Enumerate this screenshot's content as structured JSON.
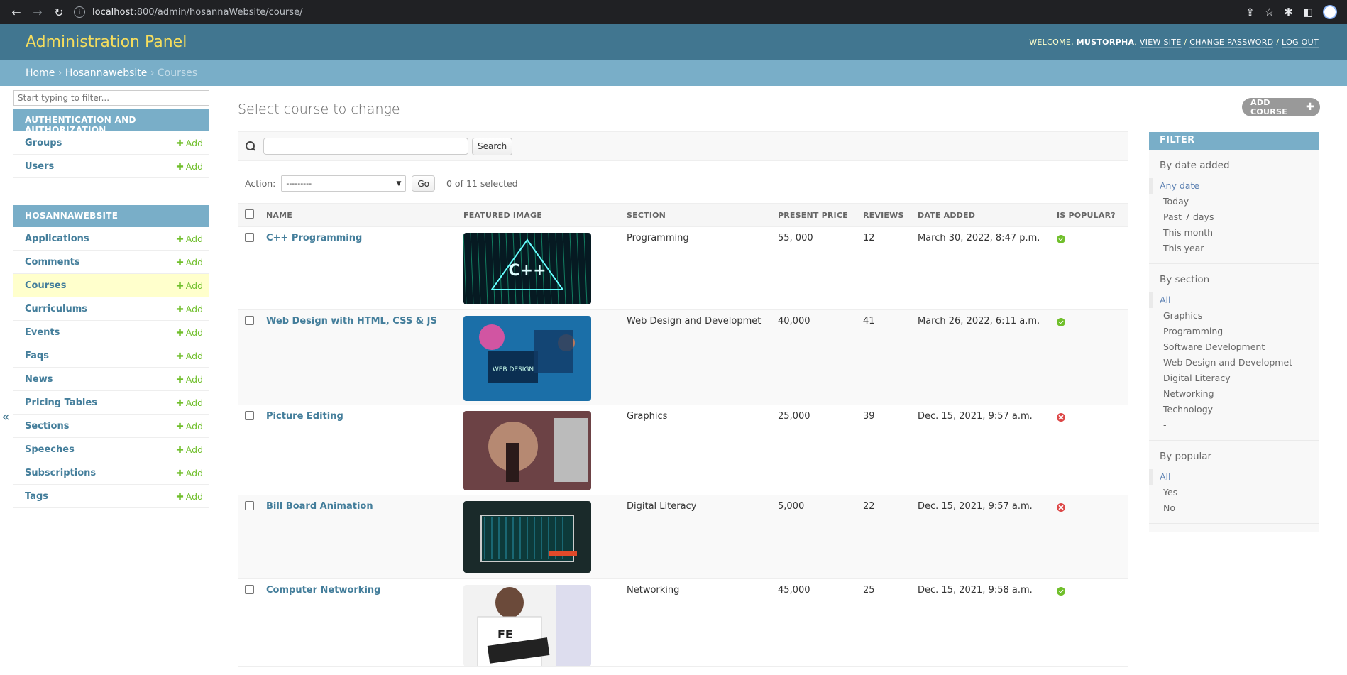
{
  "browser": {
    "url_host": "localhost",
    "url_rest": ":800/admin/hosannaWebsite/course/"
  },
  "header": {
    "branding": "Administration Panel",
    "welcome": "Welcome, ",
    "username": "MUSTORPHA",
    "view_site": "View site",
    "change_password": "Change password",
    "log_out": "Log out"
  },
  "breadcrumbs": {
    "home": "Home",
    "app": "Hosannawebsite",
    "current": "Courses"
  },
  "sidebar": {
    "filter_placeholder": "Start typing to filter...",
    "add_label": "Add",
    "auth_caption": "Authentication and Authorization",
    "auth_models": [
      "Groups",
      "Users"
    ],
    "app_caption": "Hosannawebsite",
    "app_models": [
      "Applications",
      "Comments",
      "Courses",
      "Curriculums",
      "Events",
      "Faqs",
      "News",
      "Pricing Tables",
      "Sections",
      "Speeches",
      "Subscriptions",
      "Tags"
    ],
    "current_model": "Courses",
    "toggle_icon": "«"
  },
  "content": {
    "title": "Select course to change",
    "add_button": "Add course",
    "search_button": "Search",
    "action_label": "Action:",
    "action_selected": "---------",
    "go_button": "Go",
    "counter": "0 of 11 selected"
  },
  "table": {
    "headers": [
      "Name",
      "Featured image",
      "Section",
      "Present price",
      "Reviews",
      "Date added",
      "Is popular?"
    ],
    "rows": [
      {
        "name": "C++ Programming",
        "section": "Programming",
        "price": "55, 000",
        "reviews": "12",
        "date": "March 30, 2022, 8:47 p.m.",
        "popular": true
      },
      {
        "name": "Web Design with HTML, CSS & JS",
        "section": "Web Design and Developmet",
        "price": "40,000",
        "reviews": "41",
        "date": "March 26, 2022, 6:11 a.m.",
        "popular": true
      },
      {
        "name": "Picture Editing",
        "section": "Graphics",
        "price": "25,000",
        "reviews": "39",
        "date": "Dec. 15, 2021, 9:57 a.m.",
        "popular": false
      },
      {
        "name": "Bill Board Animation",
        "section": "Digital Literacy",
        "price": "5,000",
        "reviews": "22",
        "date": "Dec. 15, 2021, 9:57 a.m.",
        "popular": false
      },
      {
        "name": "Computer Networking",
        "section": "Networking",
        "price": "45,000",
        "reviews": "25",
        "date": "Dec. 15, 2021, 9:58 a.m.",
        "popular": true
      }
    ],
    "thumb_text": [
      "C++",
      "WEB DESIGN",
      "",
      "",
      "FE"
    ]
  },
  "filter": {
    "title": "Filter",
    "groups": [
      {
        "title": "By date added",
        "items": [
          "Any date",
          "Today",
          "Past 7 days",
          "This month",
          "This year"
        ]
      },
      {
        "title": "By section",
        "items": [
          "All",
          "Graphics",
          "Programming",
          "Software Development",
          "Web Design and Developmet",
          "Digital Literacy",
          "Networking",
          "Technology",
          "-"
        ]
      },
      {
        "title": "By popular",
        "items": [
          "All",
          "Yes",
          "No"
        ]
      }
    ]
  },
  "colors": {
    "header_bg": "#417690",
    "breadcrumb_bg": "#79aec8",
    "branding": "#f5dd5d",
    "link": "#447e9b",
    "add_green": "#70bf2b",
    "current_row": "#ffffcc"
  }
}
